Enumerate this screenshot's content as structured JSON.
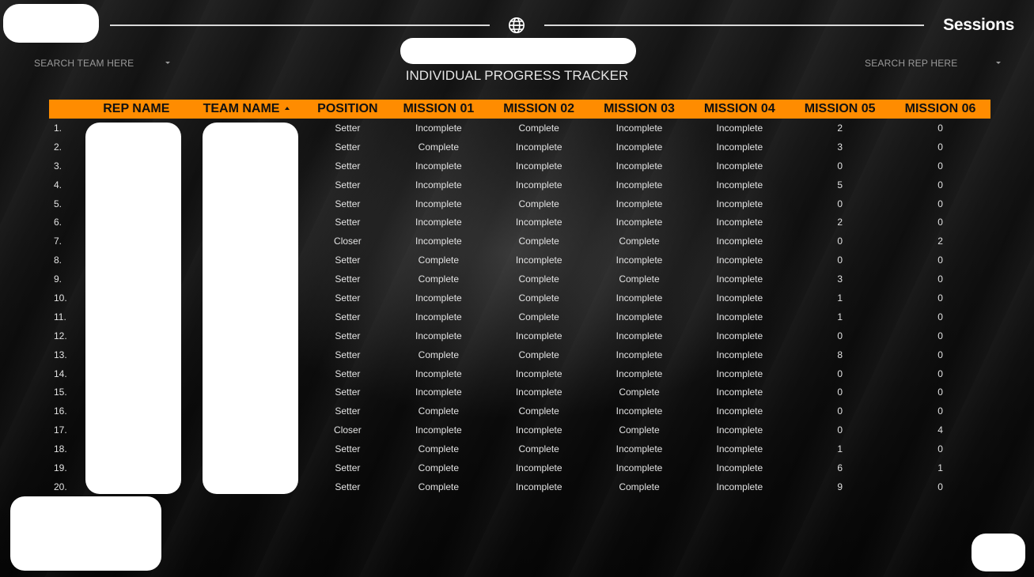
{
  "header": {
    "brand": "Sessions",
    "subtitle": "INDIVIDUAL PROGRESS TRACKER",
    "search_team": "SEARCH TEAM HERE",
    "search_rep": "SEARCH REP HERE",
    "globe_icon": "globe-icon"
  },
  "table": {
    "columns": [
      "REP NAME",
      "TEAM NAME",
      "POSITION",
      "MISSION 01",
      "MISSION 02",
      "MISSION 03",
      "MISSION 04",
      "MISSION 05",
      "MISSION 06"
    ],
    "sort_icon": "sort-ascending-icon",
    "rows": [
      {
        "num": "1.",
        "rep": "",
        "team": "",
        "position": "Setter",
        "m1": "Incomplete",
        "m2": "Complete",
        "m3": "Incomplete",
        "m4": "Incomplete",
        "m5": "2",
        "m6": "0"
      },
      {
        "num": "2.",
        "rep": "",
        "team": "",
        "position": "Setter",
        "m1": "Complete",
        "m2": "Incomplete",
        "m3": "Incomplete",
        "m4": "Incomplete",
        "m5": "3",
        "m6": "0"
      },
      {
        "num": "3.",
        "rep": "",
        "team": "",
        "position": "Setter",
        "m1": "Incomplete",
        "m2": "Incomplete",
        "m3": "Incomplete",
        "m4": "Incomplete",
        "m5": "0",
        "m6": "0"
      },
      {
        "num": "4.",
        "rep": "",
        "team": "",
        "position": "Setter",
        "m1": "Incomplete",
        "m2": "Incomplete",
        "m3": "Incomplete",
        "m4": "Incomplete",
        "m5": "5",
        "m6": "0"
      },
      {
        "num": "5.",
        "rep": "",
        "team": "",
        "position": "Setter",
        "m1": "Incomplete",
        "m2": "Complete",
        "m3": "Incomplete",
        "m4": "Incomplete",
        "m5": "0",
        "m6": "0"
      },
      {
        "num": "6.",
        "rep": "",
        "team": "",
        "position": "Setter",
        "m1": "Incomplete",
        "m2": "Incomplete",
        "m3": "Incomplete",
        "m4": "Incomplete",
        "m5": "2",
        "m6": "0"
      },
      {
        "num": "7.",
        "rep": "",
        "team": "",
        "position": "Closer",
        "m1": "Incomplete",
        "m2": "Complete",
        "m3": "Complete",
        "m4": "Incomplete",
        "m5": "0",
        "m6": "2"
      },
      {
        "num": "8.",
        "rep": "",
        "team": "",
        "position": "Setter",
        "m1": "Complete",
        "m2": "Incomplete",
        "m3": "Incomplete",
        "m4": "Incomplete",
        "m5": "0",
        "m6": "0"
      },
      {
        "num": "9.",
        "rep": "",
        "team": "",
        "position": "Setter",
        "m1": "Complete",
        "m2": "Complete",
        "m3": "Complete",
        "m4": "Incomplete",
        "m5": "3",
        "m6": "0"
      },
      {
        "num": "10.",
        "rep": "",
        "team": "",
        "position": "Setter",
        "m1": "Incomplete",
        "m2": "Complete",
        "m3": "Incomplete",
        "m4": "Incomplete",
        "m5": "1",
        "m6": "0"
      },
      {
        "num": "11.",
        "rep": "",
        "team": "",
        "position": "Setter",
        "m1": "Incomplete",
        "m2": "Complete",
        "m3": "Incomplete",
        "m4": "Incomplete",
        "m5": "1",
        "m6": "0"
      },
      {
        "num": "12.",
        "rep": "",
        "team": "",
        "position": "Setter",
        "m1": "Incomplete",
        "m2": "Incomplete",
        "m3": "Incomplete",
        "m4": "Incomplete",
        "m5": "0",
        "m6": "0"
      },
      {
        "num": "13.",
        "rep": "",
        "team": "",
        "position": "Setter",
        "m1": "Complete",
        "m2": "Complete",
        "m3": "Incomplete",
        "m4": "Incomplete",
        "m5": "8",
        "m6": "0"
      },
      {
        "num": "14.",
        "rep": "",
        "team": "",
        "position": "Setter",
        "m1": "Incomplete",
        "m2": "Incomplete",
        "m3": "Incomplete",
        "m4": "Incomplete",
        "m5": "0",
        "m6": "0"
      },
      {
        "num": "15.",
        "rep": "",
        "team": "",
        "position": "Setter",
        "m1": "Incomplete",
        "m2": "Incomplete",
        "m3": "Complete",
        "m4": "Incomplete",
        "m5": "0",
        "m6": "0"
      },
      {
        "num": "16.",
        "rep": "",
        "team": "",
        "position": "Setter",
        "m1": "Complete",
        "m2": "Complete",
        "m3": "Incomplete",
        "m4": "Incomplete",
        "m5": "0",
        "m6": "0"
      },
      {
        "num": "17.",
        "rep": "",
        "team": "",
        "position": "Closer",
        "m1": "Incomplete",
        "m2": "Incomplete",
        "m3": "Complete",
        "m4": "Incomplete",
        "m5": "0",
        "m6": "4"
      },
      {
        "num": "18.",
        "rep": "",
        "team": "",
        "position": "Setter",
        "m1": "Complete",
        "m2": "Complete",
        "m3": "Incomplete",
        "m4": "Incomplete",
        "m5": "1",
        "m6": "0"
      },
      {
        "num": "19.",
        "rep": "",
        "team": "",
        "position": "Setter",
        "m1": "Complete",
        "m2": "Incomplete",
        "m3": "Incomplete",
        "m4": "Incomplete",
        "m5": "6",
        "m6": "1"
      },
      {
        "num": "20.",
        "rep": "",
        "team": "",
        "position": "Setter",
        "m1": "Complete",
        "m2": "Incomplete",
        "m3": "Complete",
        "m4": "Incomplete",
        "m5": "9",
        "m6": "0"
      }
    ]
  },
  "colors": {
    "accent": "#ff8c00",
    "background": "#111111",
    "text": "#e2e2e2"
  }
}
